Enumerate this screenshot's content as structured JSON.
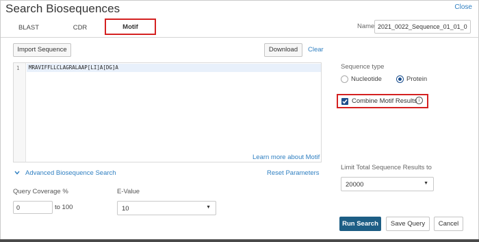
{
  "window": {
    "title": "Search Biosequences",
    "close_label": "Close"
  },
  "tabs": [
    {
      "label": "BLAST",
      "active": false
    },
    {
      "label": "CDR",
      "active": false
    },
    {
      "label": "Motif",
      "active": true
    }
  ],
  "name_field": {
    "label": "Name",
    "value": "2021_0022_Sequence_01_01_01_("
  },
  "toolbar": {
    "import_label": "Import Sequence",
    "download_label": "Download",
    "clear_label": "Clear"
  },
  "editor": {
    "line_number": "1",
    "sequence": "MRAVIFFLLCLAGRALAAP[LI]A[DG]A",
    "learn_more_label": "Learn more about Motif"
  },
  "advanced": {
    "toggle_label": "Advanced Biosequence Search",
    "toggle_icon": "chevron-down-icon",
    "reset_label": "Reset Parameters",
    "query_coverage_label": "Query Coverage %",
    "query_coverage_from": "0",
    "query_coverage_to_text": "to 100",
    "evalue_label": "E-Value",
    "evalue_selected": "10"
  },
  "sequence_type": {
    "label": "Sequence type",
    "options": [
      {
        "label": "Nucleotide",
        "selected": false
      },
      {
        "label": "Protein",
        "selected": true
      }
    ]
  },
  "combine": {
    "label": "Combine Motif Results",
    "checked": true,
    "info_icon": "info-icon"
  },
  "limit": {
    "label": "Limit Total Sequence Results to",
    "selected": "20000"
  },
  "actions": {
    "run_label": "Run Search",
    "save_label": "Save Query",
    "cancel_label": "Cancel"
  },
  "colors": {
    "accent_link": "#2f7fc1",
    "primary_button": "#1d5e85",
    "highlight_box": "#d42020",
    "radio_selected": "#1b4f8f"
  }
}
